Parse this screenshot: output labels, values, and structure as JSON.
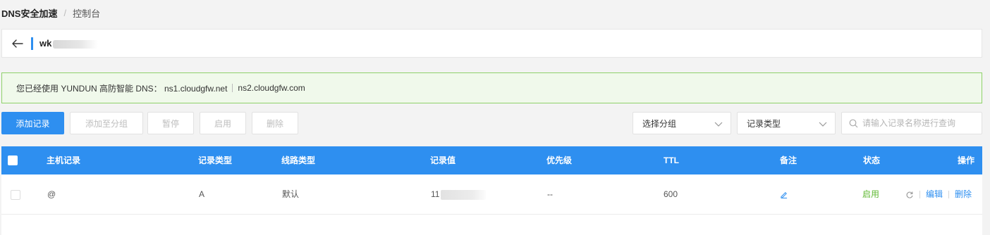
{
  "breadcrumb": {
    "main": "DNS安全加速",
    "separator": "/",
    "sub": "控制台"
  },
  "title_bar": {
    "domain": "wk"
  },
  "notice": {
    "text": "您已经使用 YUNDUN 高防智能 DNS： ns1.cloudgfw.net",
    "ns2": "ns2.cloudgfw.com"
  },
  "toolbar": {
    "add_record": "添加记录",
    "add_to_group": "添加至分组",
    "pause": "暂停",
    "enable": "启用",
    "delete": "删除",
    "group_select": "选择分组",
    "type_select": "记录类型",
    "search_placeholder": "请输入记录名称进行查询"
  },
  "table": {
    "headers": {
      "host": "主机记录",
      "type": "记录类型",
      "line": "线路类型",
      "value": "记录值",
      "priority": "优先级",
      "ttl": "TTL",
      "remark": "备注",
      "status": "状态",
      "action": "操作"
    },
    "rows": [
      {
        "host": "@",
        "type": "A",
        "line": "默认",
        "value": "11",
        "priority": "--",
        "ttl": "600",
        "status": "启用",
        "edit": "编辑",
        "delete": "删除"
      }
    ]
  },
  "colors": {
    "primary": "#2e8ff0",
    "success": "#5fb832",
    "notice_bg": "#f0f9eb",
    "notice_border": "#8fd16a"
  },
  "icons": [
    "back-arrow-icon",
    "chevron-down-icon",
    "search-icon",
    "pencil-icon",
    "refresh-icon"
  ]
}
